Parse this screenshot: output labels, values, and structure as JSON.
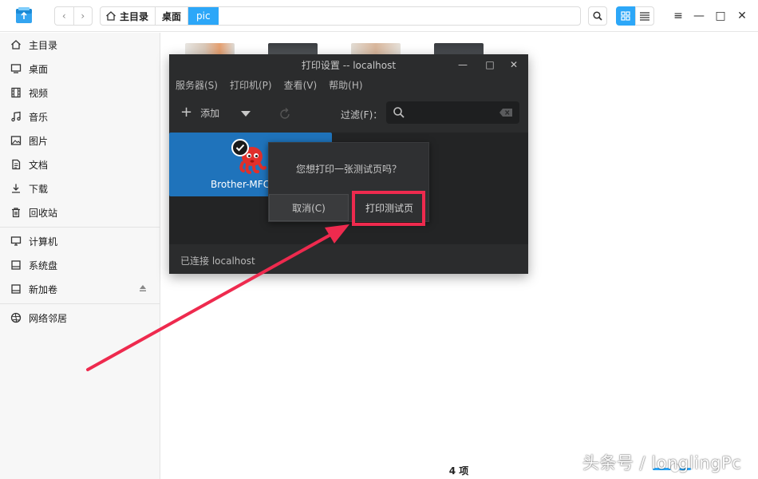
{
  "window": {
    "nav_back": "‹",
    "nav_forward": "›"
  },
  "breadcrumb": {
    "items": [
      "主目录",
      "桌面",
      "pic"
    ]
  },
  "toolbar": {
    "search_icon": "search-icon",
    "icon_view_icon": "grid-icon",
    "list_view_icon": "list-icon"
  },
  "window_controls": {
    "menu": "≡",
    "minimize": "—",
    "maximize": "□",
    "close": "✕"
  },
  "sidebar": {
    "items": [
      {
        "label": "主目录",
        "icon": "home-icon"
      },
      {
        "label": "桌面",
        "icon": "desktop-icon"
      },
      {
        "label": "视频",
        "icon": "video-icon"
      },
      {
        "label": "音乐",
        "icon": "music-icon"
      },
      {
        "label": "图片",
        "icon": "picture-icon"
      },
      {
        "label": "文档",
        "icon": "document-icon"
      },
      {
        "label": "下载",
        "icon": "download-icon"
      },
      {
        "label": "回收站",
        "icon": "trash-icon"
      }
    ],
    "devices": [
      {
        "label": "计算机",
        "icon": "computer-icon"
      },
      {
        "label": "系统盘",
        "icon": "drive-icon"
      },
      {
        "label": "新加卷",
        "icon": "drive-icon"
      }
    ],
    "network": [
      {
        "label": "网络邻居",
        "icon": "network-icon"
      }
    ]
  },
  "status": {
    "item_count": "4 项"
  },
  "watermark": "头条号 / longlingPc",
  "print_window": {
    "title": "打印设置 -- localhost",
    "menu": [
      "服务器(S)",
      "打印机(P)",
      "查看(V)",
      "帮助(H)"
    ],
    "add_label": "添加",
    "filter_label": "过滤(F)：",
    "printer_name": "Brother-MFC-",
    "status_text": "已连接 localhost"
  },
  "dialog": {
    "message": "您想打印一张测试页吗？",
    "cancel_label": "取消(C)",
    "ok_label": "打印测试页"
  },
  "colors": {
    "accent": "#2ca7f8",
    "highlight": "#ee2a4e",
    "dark_window": "#2b2c2d",
    "printer_card": "#1f73bb"
  }
}
